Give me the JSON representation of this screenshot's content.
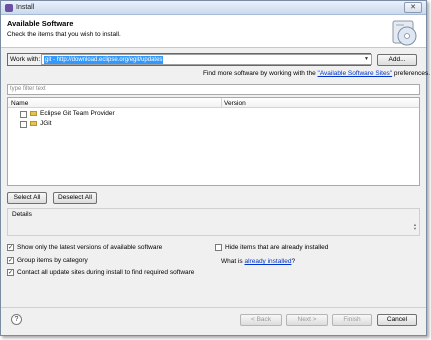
{
  "window": {
    "title": "Install",
    "close_glyph": "✕"
  },
  "header": {
    "title": "Available Software",
    "subtitle": "Check the items that you wish to install."
  },
  "work_with": {
    "label": "Work with:",
    "value": "git - http://download.eclipse.org/egit/updates",
    "add_label": "Add..."
  },
  "more_sites": {
    "prefix": "Find more software by working with the ",
    "link": "\"Available Software Sites\"",
    "suffix": " preferences."
  },
  "filter": {
    "placeholder": "type filter text"
  },
  "tree": {
    "columns": [
      "Name",
      "Version"
    ],
    "items": [
      {
        "label": "Eclipse Git Team Provider",
        "version": ""
      },
      {
        "label": "JGit",
        "version": ""
      }
    ]
  },
  "selection_buttons": {
    "select_all": "Select All",
    "deselect_all": "Deselect All"
  },
  "details": {
    "label": "Details"
  },
  "options": {
    "latest_versions": {
      "label": "Show only the latest versions of available software",
      "checked": true
    },
    "group_by_category": {
      "label": "Group items by category",
      "checked": true
    },
    "contact_sites": {
      "label": "Contact all update sites during install to find required software",
      "checked": true
    },
    "hide_installed": {
      "label": "Hide items that are already installed",
      "checked": false
    }
  },
  "what_is": {
    "prefix": "What is ",
    "link": "already installed",
    "suffix": "?"
  },
  "footer": {
    "help_glyph": "?",
    "back": "< Back",
    "next": "Next >",
    "finish": "Finish",
    "cancel": "Cancel"
  },
  "icons": {
    "title_icon": "eclipse-install-icon",
    "banner_icon": "install-cd-icon",
    "folder_icon": "feature-folder-icon",
    "help_icon": "help-icon"
  }
}
